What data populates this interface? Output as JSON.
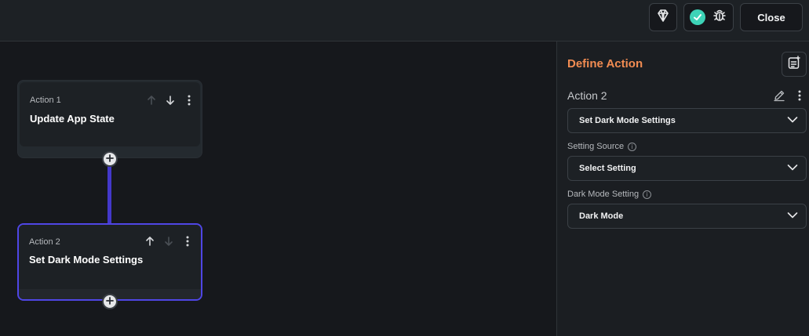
{
  "topbar": {
    "close_label": "Close",
    "icons": [
      "gem-icon",
      "check-icon",
      "bug-icon"
    ],
    "status_color": "#3dd3b7"
  },
  "flow": {
    "actions": [
      {
        "label": "Action 1",
        "title": "Update App State"
      },
      {
        "label": "Action 2",
        "title": "Set Dark Mode Settings"
      }
    ],
    "connector_color": "#4338ca",
    "selected_border_color": "#4f46e5"
  },
  "panel": {
    "title": "Define Action",
    "title_color": "#f28c52",
    "action_name": "Action 2",
    "action_type": "Set Dark Mode Settings",
    "setting_source_label": "Setting Source",
    "setting_source_value": "Select Setting",
    "dark_mode_label": "Dark Mode Setting",
    "dark_mode_value": "Dark Mode",
    "info_glyph": "i"
  }
}
